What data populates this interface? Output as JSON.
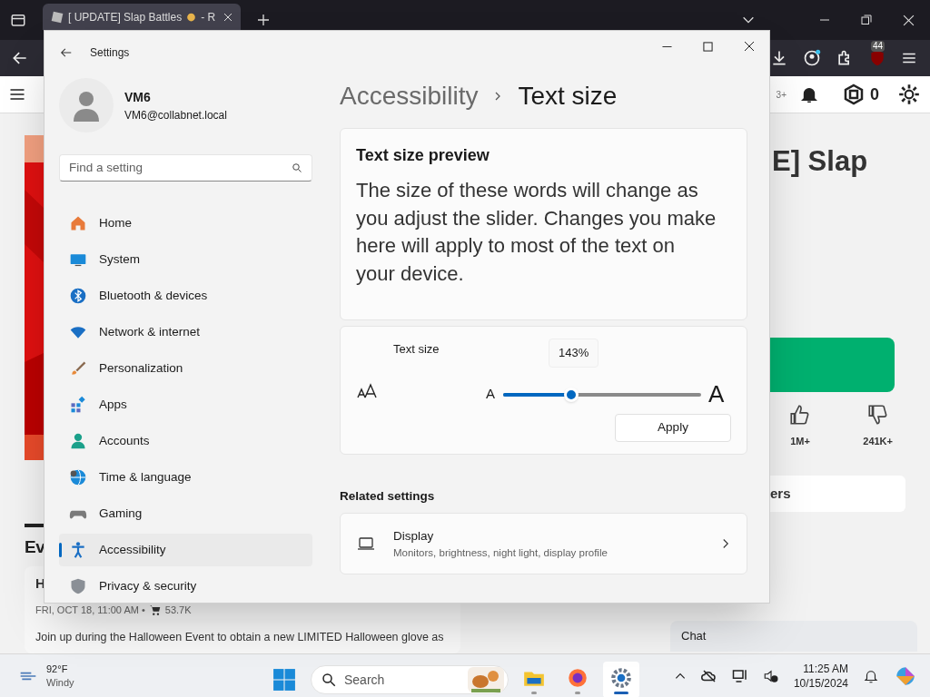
{
  "browser": {
    "tab": {
      "title": "[ UPDATE] Slap Battles",
      "title_end": "- R"
    },
    "extension_badge": "44",
    "page": {
      "age_badge": "3+",
      "robux": "0",
      "game_title": "E] Slap",
      "likes": "1M+",
      "dislikes": "241K+",
      "card_title": "ers",
      "section_heading": "Ev",
      "event_title": "H",
      "event_meta": "FRI, OCT 18, 11:00 AM •",
      "event_count": "53.7K",
      "event_text": "Join up during the Halloween Event to obtain a new LIMITED Halloween glove as",
      "chat": "Chat"
    }
  },
  "settings": {
    "window": {
      "title": "Settings"
    },
    "account": {
      "name": "VM6",
      "email": "VM6@collabnet.local"
    },
    "search": {
      "placeholder": "Find a setting"
    },
    "nav": [
      {
        "label": "Home",
        "selected": false
      },
      {
        "label": "System",
        "selected": false
      },
      {
        "label": "Bluetooth & devices",
        "selected": false
      },
      {
        "label": "Network & internet",
        "selected": false
      },
      {
        "label": "Personalization",
        "selected": false
      },
      {
        "label": "Apps",
        "selected": false
      },
      {
        "label": "Accounts",
        "selected": false
      },
      {
        "label": "Time & language",
        "selected": false
      },
      {
        "label": "Gaming",
        "selected": false
      },
      {
        "label": "Accessibility",
        "selected": true
      },
      {
        "label": "Privacy & security",
        "selected": false
      }
    ],
    "breadcrumb": [
      "Accessibility",
      "Text size"
    ],
    "preview": {
      "title": "Text size preview",
      "text": "The size of these words will change as you adjust the slider. Changes you make here will apply to most of the text on your device."
    },
    "text_size": {
      "label": "Text size",
      "reading": "143%",
      "min_label": "A",
      "max_label": "A",
      "level": 0.344,
      "apply": "Apply"
    },
    "related": {
      "heading": "Related settings",
      "items": [
        {
          "title": "Display",
          "subtitle": "Monitors, brightness, night light, display profile"
        }
      ]
    }
  },
  "taskbar": {
    "weather": {
      "temp": "92°F",
      "condition": "Windy"
    },
    "search": {
      "placeholder": "Search"
    },
    "apps": [
      {
        "selected": false
      },
      {
        "selected": false
      },
      {
        "selected": true
      }
    ],
    "time": "11:25 AM",
    "date": "10/15/2024"
  }
}
